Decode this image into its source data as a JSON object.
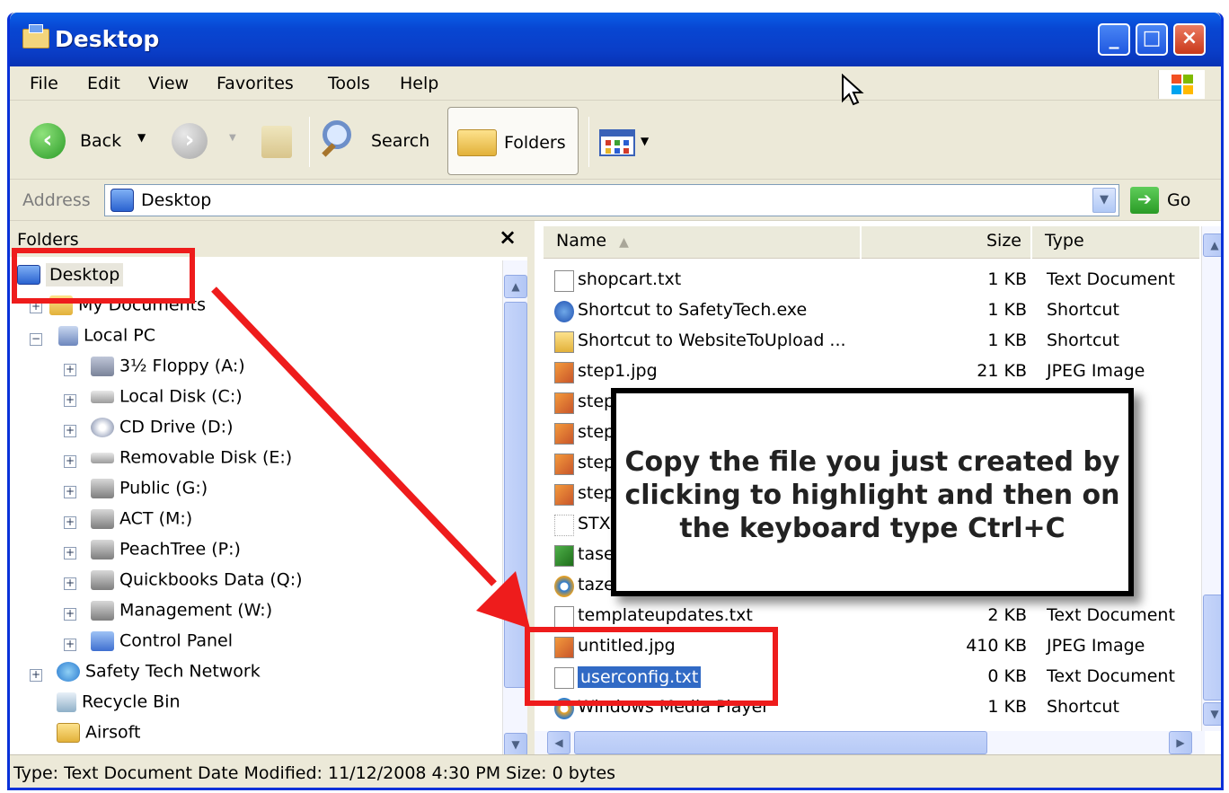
{
  "window": {
    "title": "Desktop"
  },
  "menu": [
    "File",
    "Edit",
    "View",
    "Favorites",
    "Tools",
    "Help"
  ],
  "toolbar": {
    "back_label": "Back",
    "search_label": "Search",
    "folders_label": "Folders"
  },
  "address": {
    "label": "Address",
    "value": "Desktop",
    "go_label": "Go"
  },
  "folders_pane": {
    "title": "Folders",
    "close_glyph": "×",
    "tree": [
      {
        "label": "Desktop"
      },
      {
        "label": "My Documents"
      },
      {
        "label": "Local PC"
      },
      {
        "label": "3½ Floppy (A:)"
      },
      {
        "label": "Local Disk (C:)"
      },
      {
        "label": "CD Drive (D:)"
      },
      {
        "label": "Removable Disk (E:)"
      },
      {
        "label": "Public (G:)"
      },
      {
        "label": "ACT (M:)"
      },
      {
        "label": "PeachTree (P:)"
      },
      {
        "label": "Quickbooks Data (Q:)"
      },
      {
        "label": "Management (W:)"
      },
      {
        "label": "Control Panel"
      },
      {
        "label": "Safety Tech Network"
      },
      {
        "label": "Recycle Bin"
      },
      {
        "label": "Airsoft"
      }
    ]
  },
  "files_pane": {
    "columns": {
      "name": "Name",
      "size": "Size",
      "type": "Type"
    },
    "rows": [
      {
        "name": "shopcart.txt",
        "size": "1 KB",
        "type": "Text Document"
      },
      {
        "name": "Shortcut to SafetyTech.exe",
        "size": "1 KB",
        "type": "Shortcut"
      },
      {
        "name": "Shortcut to WebsiteToUpload ...",
        "size": "1 KB",
        "type": "Shortcut"
      },
      {
        "name": "step1.jpg",
        "size": "21 KB",
        "type": "JPEG Image"
      },
      {
        "name": "step",
        "size": "",
        "type": "e"
      },
      {
        "name": "step",
        "size": "",
        "type": "e"
      },
      {
        "name": "step",
        "size": "",
        "type": "e"
      },
      {
        "name": "step",
        "size": "",
        "type": "e"
      },
      {
        "name": "STXN",
        "size": "",
        "type": "/ X3 G"
      },
      {
        "name": "tase",
        "size": "",
        "type": "xcel V"
      },
      {
        "name": "taze",
        "size": "",
        "type": "edia A"
      },
      {
        "name": "templateupdates.txt",
        "size": "2 KB",
        "type": "Text Document"
      },
      {
        "name": "untitled.jpg",
        "size": "410 KB",
        "type": "JPEG Image"
      },
      {
        "name": "userconfig.txt",
        "size": "0 KB",
        "type": "Text Document"
      },
      {
        "name": "Windows Media Player",
        "size": "1 KB",
        "type": "Shortcut"
      }
    ]
  },
  "callout": {
    "lines": [
      "Copy the file you just created by",
      "clicking to highlight and then on",
      "the keyboard type Ctrl+C"
    ]
  },
  "status": {
    "text": "Type: Text Document Date Modified: 11/12/2008 4:30 PM Size: 0 bytes"
  },
  "colors": {
    "titlebar": "#0a3ec8",
    "selection": "#316ac5",
    "annotation_red": "#ee1c1c",
    "chrome": "#ece9d8"
  }
}
